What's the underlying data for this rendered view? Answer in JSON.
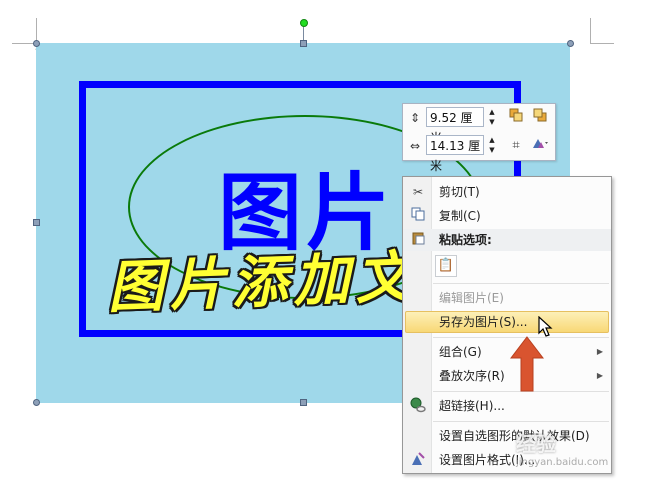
{
  "picture": {
    "big_text": "图片",
    "wordart_text": "图片添加文",
    "colors": {
      "background": "#9fd8ea",
      "frame": "#0000ff",
      "ellipse": "#0a7a0a",
      "big_text": "#0000ff",
      "wordart": "#ffff33"
    }
  },
  "size_toolbar": {
    "height_value": "9.52 厘米",
    "width_value": "14.13 厘米",
    "icons": [
      "height-icon",
      "bring-forward-icon",
      "send-backward-icon",
      "width-icon",
      "crop-icon",
      "picture-styles-icon"
    ]
  },
  "context_menu": {
    "items": [
      {
        "label": "剪切(T)",
        "icon": "scissors-icon"
      },
      {
        "label": "复制(C)",
        "icon": "copy-icon"
      },
      {
        "label": "粘贴选项:",
        "icon": "paste-icon"
      },
      {
        "label": "编辑图片(E)",
        "icon": ""
      },
      {
        "label": "另存为图片(S)...",
        "icon": ""
      },
      {
        "label": "组合(G)",
        "icon": ""
      },
      {
        "label": "叠放次序(R)",
        "icon": ""
      },
      {
        "label": "超链接(H)...",
        "icon": "hyperlink-icon"
      },
      {
        "label": "设置自选图形的默认效果(D)",
        "icon": ""
      },
      {
        "label": "设置图片格式(I)...",
        "icon": "format-picture-icon"
      }
    ],
    "highlight_color": "#f8d876"
  },
  "watermark": {
    "text": "经验",
    "sub": "jingyan.baidu.com"
  },
  "annotation_arrow_color": "#d9542f"
}
